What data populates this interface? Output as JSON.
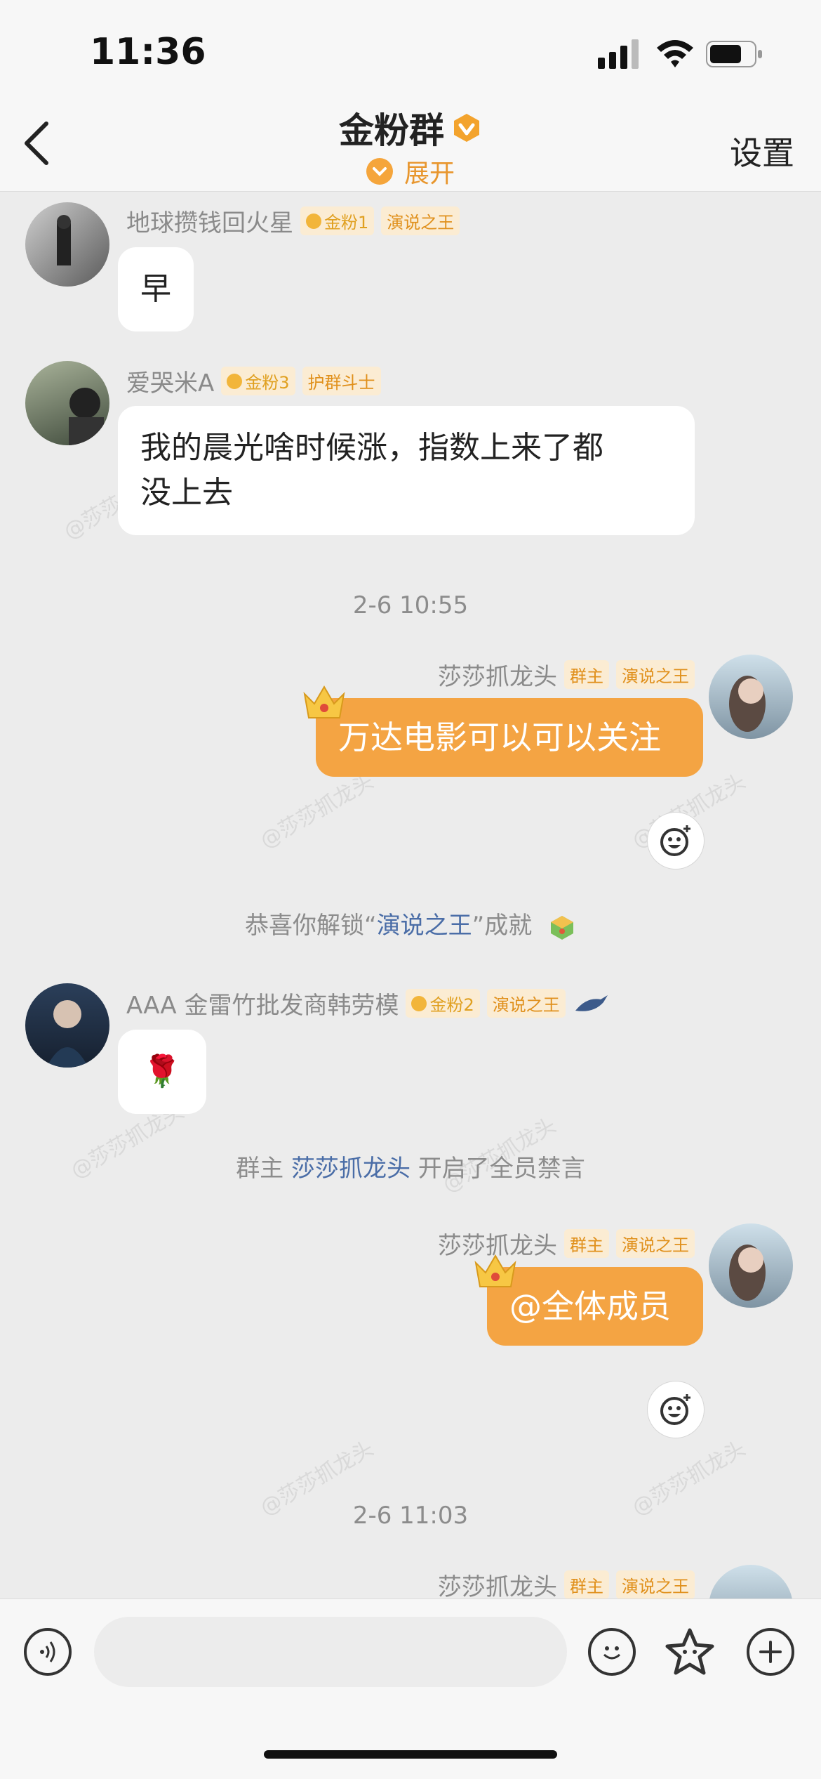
{
  "status_bar": {
    "time": "11:36"
  },
  "header": {
    "title": "金粉群",
    "expand_label": "展开",
    "settings_label": "设置",
    "accent_color": "#f4a443"
  },
  "messages": [
    {
      "sender": "地球攒钱回火星",
      "badges": [
        "金粉1",
        "演说之王"
      ],
      "text": "早"
    },
    {
      "sender": "爱哭米A",
      "badges": [
        "金粉3",
        "护群斗士"
      ],
      "text_line1": "我的晨光啥时候涨，指数上来了都",
      "text_line2": "没上去"
    },
    {
      "timestamp": "2-6 10:55"
    },
    {
      "sender": "莎莎抓龙头",
      "badges": [
        "群主",
        "演说之王"
      ],
      "text": "万达电影可以可以关注"
    },
    {
      "system_prefix": "恭喜你解锁“",
      "system_link": "演说之王",
      "system_suffix": "”成就"
    },
    {
      "sender": "AAA 金雷竹批发商韩劳模",
      "badges": [
        "金粉2",
        "演说之王"
      ],
      "text": "🌹"
    },
    {
      "system_prefix": "群主 ",
      "system_link": "莎莎抓龙头",
      "system_suffix": " 开启了全员禁言"
    },
    {
      "sender": "莎莎抓龙头",
      "badges": [
        "群主",
        "演说之王"
      ],
      "text": "@全体成员"
    },
    {
      "timestamp": "2-6 11:03"
    },
    {
      "sender": "莎莎抓龙头",
      "badges": [
        "群主",
        "演说之王"
      ]
    }
  ],
  "watermark": "@莎莎抓龙头",
  "input_bar": {
    "icons": [
      "voice-icon",
      "emoji-icon",
      "sticker-icon",
      "plus-icon"
    ],
    "placeholder": ""
  }
}
